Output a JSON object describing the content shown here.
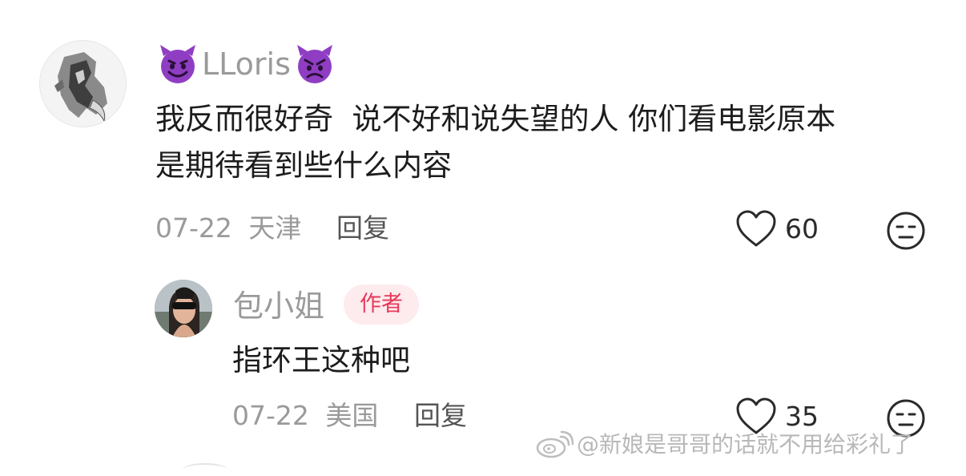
{
  "comment": {
    "username": "LLoris",
    "username_emoji_left": "smiling-devil-emoji",
    "username_emoji_right": "angry-devil-emoji",
    "text_line1": "我反而很好奇  说不好和说失望的人 你们看电影原本",
    "text_line2": "是期待看到些什么内容",
    "date": "07-22",
    "location": "天津",
    "reply_label": "回复",
    "likes": "60",
    "like_icon": "heart-outline-icon",
    "dislike_icon": "meh-face-icon"
  },
  "reply": {
    "username": "包小姐",
    "author_badge": "作者",
    "text": "指环王这种吧",
    "date": "07-22",
    "location": "美国",
    "reply_label": "回复",
    "likes": "35",
    "like_icon": "heart-outline-icon",
    "dislike_icon": "meh-face-icon"
  },
  "watermark": {
    "text": "@新娘是哥哥的话就不用给彩礼了",
    "icon": "weibo-logo-icon"
  },
  "colors": {
    "badge_text": "#e8395a",
    "badge_bg": "#fdebee",
    "meta_text": "#9a9a9a",
    "body_text": "#1c1c1c",
    "emoji_purple": "#8f3ec4"
  }
}
